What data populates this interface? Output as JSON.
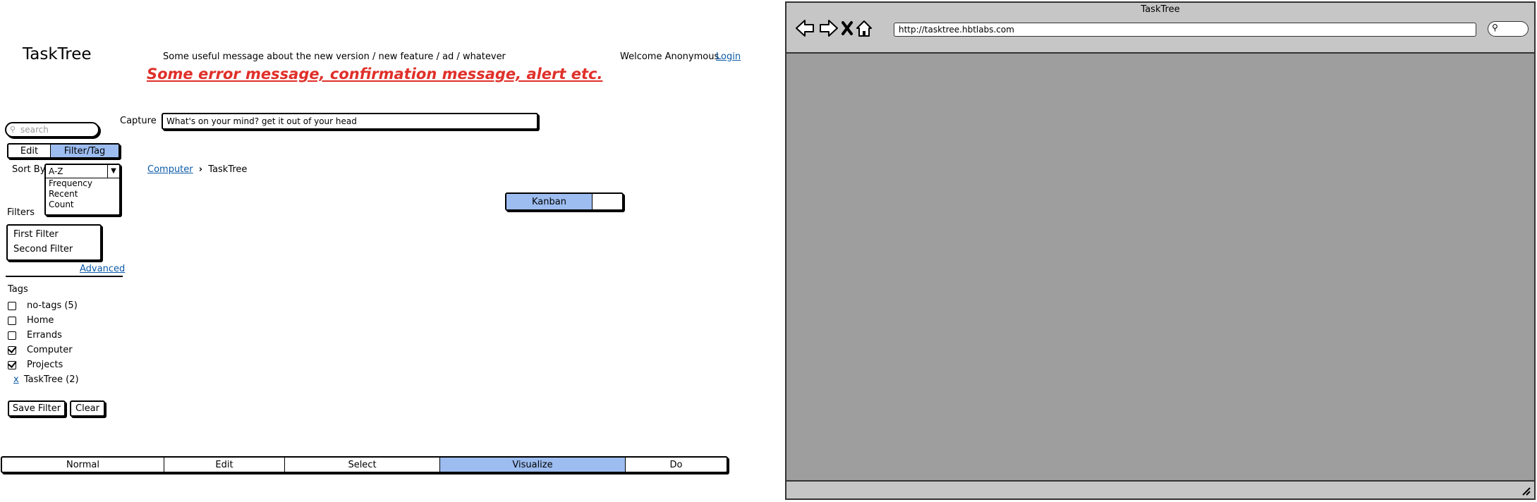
{
  "header": {
    "app_title": "TaskTree",
    "banner_message": "Some useful message about the new version / new feature / ad / whatever",
    "alert_message": "Some error message, confirmation message, alert etc.",
    "welcome_text": "Welcome Anonymous",
    "login_label": "Login"
  },
  "capture": {
    "label": "Capture",
    "value": "What's on your mind? get it out of your head"
  },
  "sidebar": {
    "search_placeholder": "search",
    "mode_tabs": [
      "Edit",
      "Filter/Tag"
    ],
    "selected_mode": "Filter/Tag",
    "sort_label": "Sort By",
    "sort_value": "A-Z",
    "sort_options": [
      "Frequency",
      "Recent",
      "Count"
    ],
    "filters_label": "Filters",
    "filters": [
      "First Filter",
      "Second Filter"
    ],
    "advanced_label": "Advanced",
    "tags_label": "Tags",
    "tags": [
      {
        "label": "no-tags (5)",
        "checked": false
      },
      {
        "label": "Home",
        "checked": false
      },
      {
        "label": "Errands",
        "checked": false
      },
      {
        "label": "Computer",
        "checked": true
      },
      {
        "label": "Projects",
        "checked": true
      }
    ],
    "subtag": {
      "remove": "x",
      "label": "TaskTree (2)"
    },
    "save_filter_label": "Save Filter",
    "clear_label": "Clear"
  },
  "breadcrumb": {
    "parent": "Computer",
    "current": "TaskTree"
  },
  "view_toggle": {
    "selected": "Kanban",
    "other": ""
  },
  "bottom_tabs": [
    "Normal",
    "Edit",
    "Select",
    "Visualize",
    "Do"
  ],
  "selected_bottom_tab": "Visualize",
  "browser": {
    "title": "TaskTree",
    "url": "http://tasktree.hbtlabs.com"
  },
  "colors": {
    "accent": "#9dbdf0",
    "alert": "#e0302a",
    "link": "#0b5aa8",
    "browser_content": "#9e9e9e"
  }
}
